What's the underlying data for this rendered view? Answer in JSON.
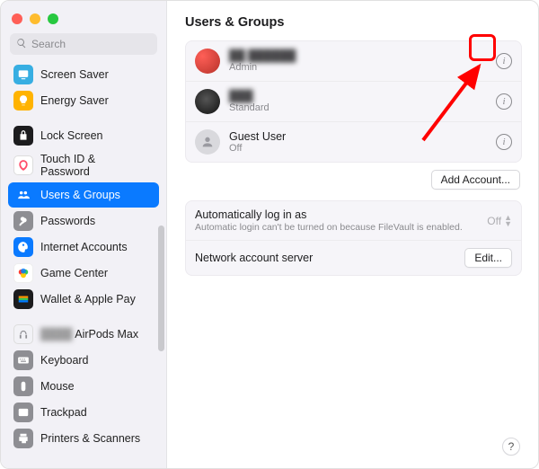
{
  "window": {
    "title": "Users & Groups"
  },
  "search": {
    "placeholder": "Search"
  },
  "sidebar": {
    "items": [
      {
        "label": "Screen Saver"
      },
      {
        "label": "Energy Saver"
      },
      {
        "label": "Lock Screen"
      },
      {
        "label": "Touch ID &\nPassword"
      },
      {
        "label": "Users & Groups"
      },
      {
        "label": "Passwords"
      },
      {
        "label": "Internet Accounts"
      },
      {
        "label": "Game Center"
      },
      {
        "label": "Wallet & Apple Pay"
      },
      {
        "label": "AirPods Max",
        "redacted_prefix": true
      },
      {
        "label": "Keyboard"
      },
      {
        "label": "Mouse"
      },
      {
        "label": "Trackpad"
      },
      {
        "label": "Printers & Scanners"
      }
    ]
  },
  "users": [
    {
      "name": "",
      "role": "Admin",
      "redacted": true,
      "highlighted": true
    },
    {
      "name": "",
      "role": "Standard",
      "redacted": true
    },
    {
      "name": "Guest User",
      "role": "Off"
    }
  ],
  "buttons": {
    "add_account": "Add Account...",
    "edit": "Edit...",
    "help": "?"
  },
  "options": {
    "auto_login": {
      "title": "Automatically log in as",
      "subtitle": "Automatic login can't be turned on because FileVault is enabled.",
      "value": "Off"
    },
    "network_server": {
      "title": "Network account server"
    }
  },
  "colors": {
    "accent": "#0a7aff",
    "annotation": "#ff0000"
  }
}
